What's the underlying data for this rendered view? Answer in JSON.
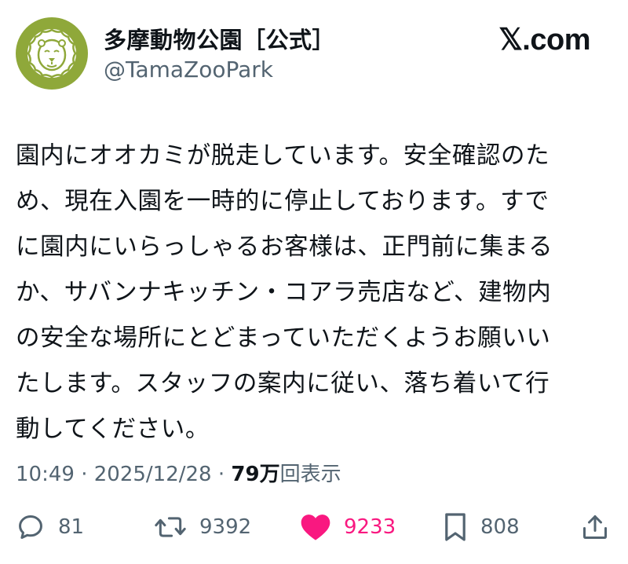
{
  "account": {
    "display_name": "多摩動物公園［公式］",
    "handle": "@TamaZooPark",
    "avatar_icon": "lion-logo-icon",
    "avatar_color": "#8fa83a"
  },
  "brand": {
    "label": "𝕏.com"
  },
  "tweet": {
    "lines": [
      "園内にオオカミが脱走しています。安全確認のた",
      "め、現在入園を一時的に停止しております。すで",
      "に園内にいらっしゃるお客様は、正門前に集まる",
      "か、サバンナキッチン・コアラ売店など、建物内",
      "の安全な場所にとどまっていただくようお願いい",
      "たします。スタッフの案内に従い、落ち着いて行",
      "動してください。"
    ]
  },
  "meta": {
    "time": "10:49",
    "separator": " · ",
    "date": "2025/12/28",
    "views_count": "79万",
    "views_label": "回表示"
  },
  "actions": {
    "reply": {
      "icon": "reply-icon",
      "count": "81"
    },
    "retweet": {
      "icon": "retweet-icon",
      "count": "9392"
    },
    "like": {
      "icon": "heart-icon",
      "count": "9233",
      "color": "#f91880"
    },
    "bookmark": {
      "icon": "bookmark-icon",
      "count": "808"
    },
    "share": {
      "icon": "share-icon"
    }
  }
}
